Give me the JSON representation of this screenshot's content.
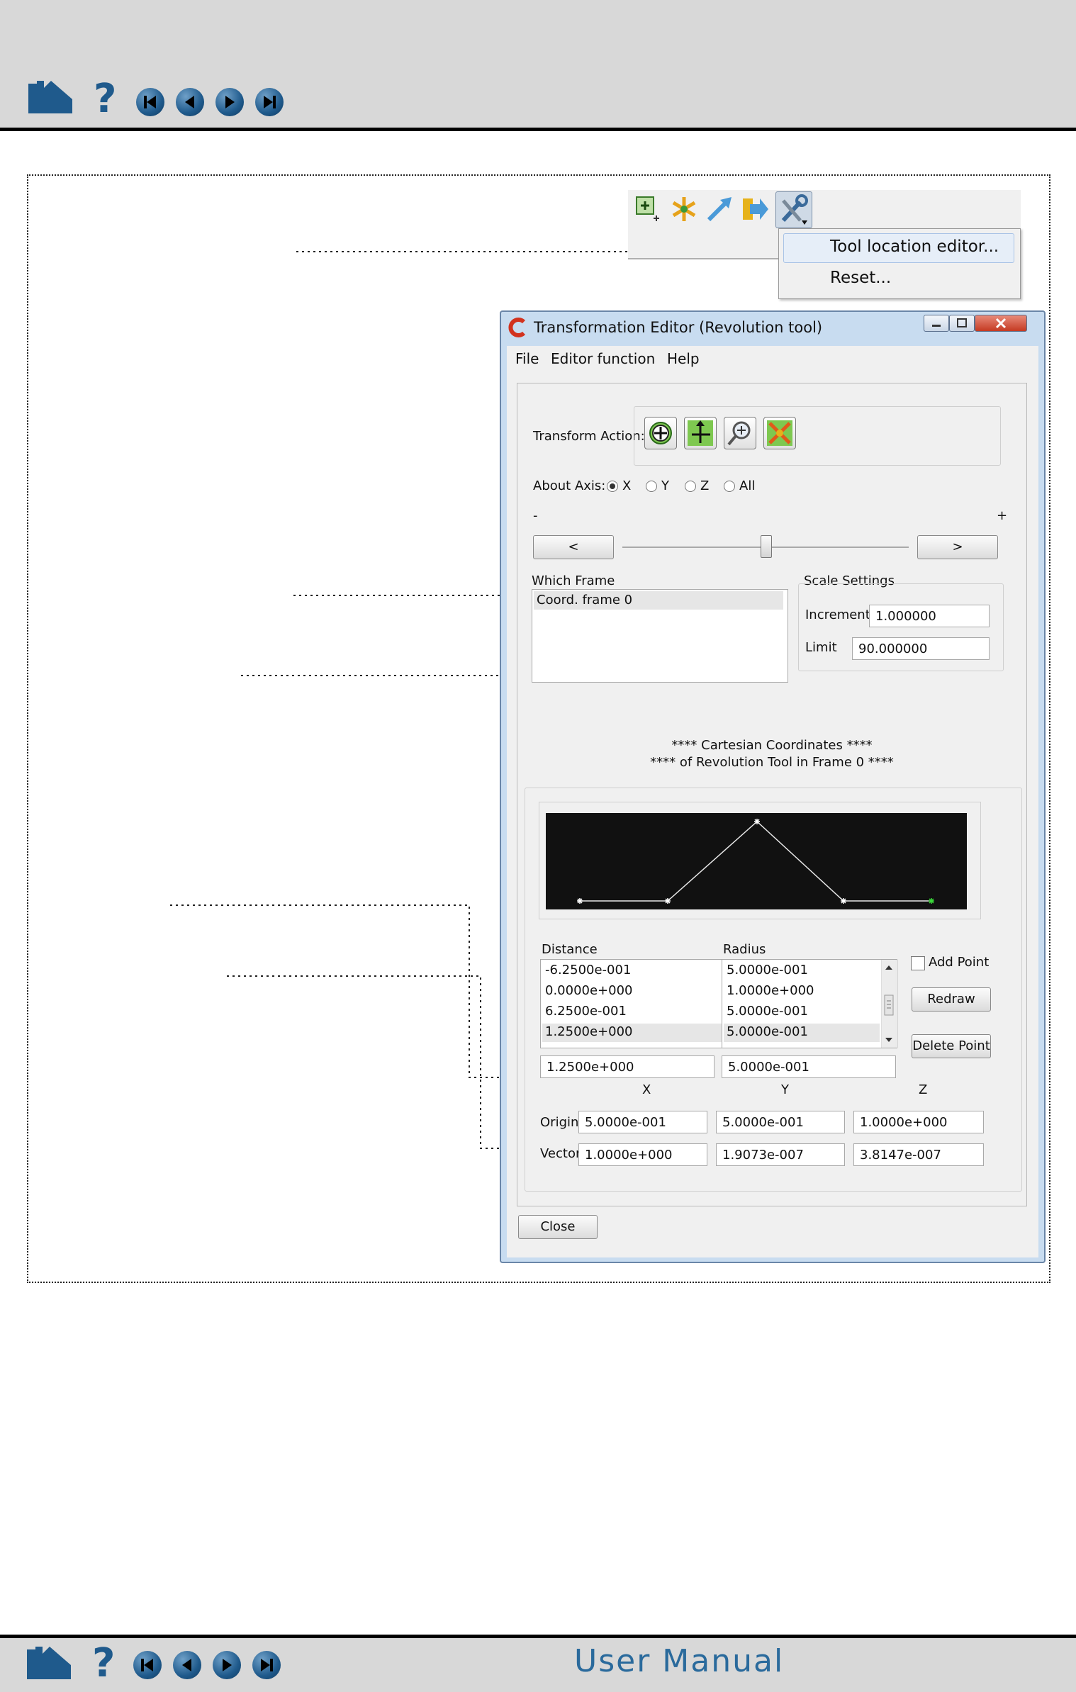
{
  "toolbar": {
    "menu": {
      "items": [
        "Tool location editor...",
        "Reset..."
      ]
    }
  },
  "window": {
    "title": "Transformation Editor (Revolution tool)",
    "menus": [
      "File",
      "Editor function",
      "Help"
    ],
    "transform_action_label": "Transform Action:",
    "about_axis_label": "About Axis:",
    "axis_options": [
      "X",
      "Y",
      "Z",
      "All"
    ],
    "axis_selected": "X",
    "slider": {
      "minus": "-",
      "plus": "+",
      "left_button": "<",
      "right_button": ">",
      "position": 0.5
    },
    "which_frame": {
      "label": "Which Frame",
      "items": [
        "Coord. frame 0"
      ]
    },
    "scale_settings": {
      "label": "Scale Settings",
      "increment_label": "Increment",
      "increment_value": "1.000000",
      "limit_label": "Limit",
      "limit_value": "90.000000"
    },
    "coords_heading_line1": "**** Cartesian Coordinates ****",
    "coords_heading_line2": "**** of Revolution Tool in Frame 0 ****",
    "distance": {
      "label": "Distance",
      "items": [
        "-6.2500e-001",
        "0.0000e+000",
        "6.2500e-001",
        "1.2500e+000"
      ],
      "selected_index": 3,
      "edit_value": "1.2500e+000"
    },
    "radius": {
      "label": "Radius",
      "items": [
        "5.0000e-001",
        "1.0000e+000",
        "5.0000e-001",
        "5.0000e-001"
      ],
      "selected_index": 3,
      "edit_value": "5.0000e-001"
    },
    "add_point_label": "Add Point",
    "redraw_label": "Redraw",
    "delete_point_label": "Delete Point",
    "xyz_headers": [
      "X",
      "Y",
      "Z"
    ],
    "origin": {
      "label": "Origin",
      "values": [
        "5.0000e-001",
        "5.0000e-001",
        "1.0000e+000"
      ]
    },
    "vector": {
      "label": "Vector",
      "values": [
        "1.0000e+000",
        "1.9073e-007",
        "3.8147e-007"
      ]
    },
    "close_label": "Close"
  },
  "footer": {
    "title": "User Manual"
  }
}
